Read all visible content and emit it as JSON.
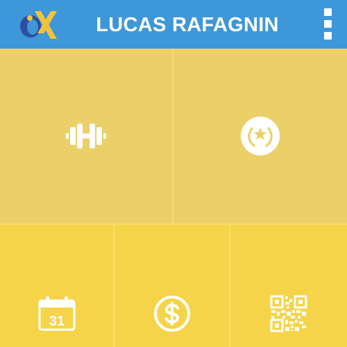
{
  "header": {
    "title": "LUCAS RAFAGNIN",
    "logo_icon": "brand-logo-icon",
    "menu_icon": "overflow-menu-icon"
  },
  "tiles": [
    {
      "name": "workout",
      "icon": "dumbbell-icon"
    },
    {
      "name": "awards",
      "icon": "laurel-star-icon"
    },
    {
      "name": "calendar",
      "icon": "calendar-icon",
      "label": "31"
    },
    {
      "name": "payment",
      "icon": "dollar-coin-icon"
    },
    {
      "name": "qr",
      "icon": "qr-code-icon"
    }
  ],
  "colors": {
    "header_bg": "#3d97d8",
    "top_tiles_bg": "#ebcf68",
    "bottom_tiles_bg": "#f5d44a",
    "icon": "#ffffff"
  }
}
